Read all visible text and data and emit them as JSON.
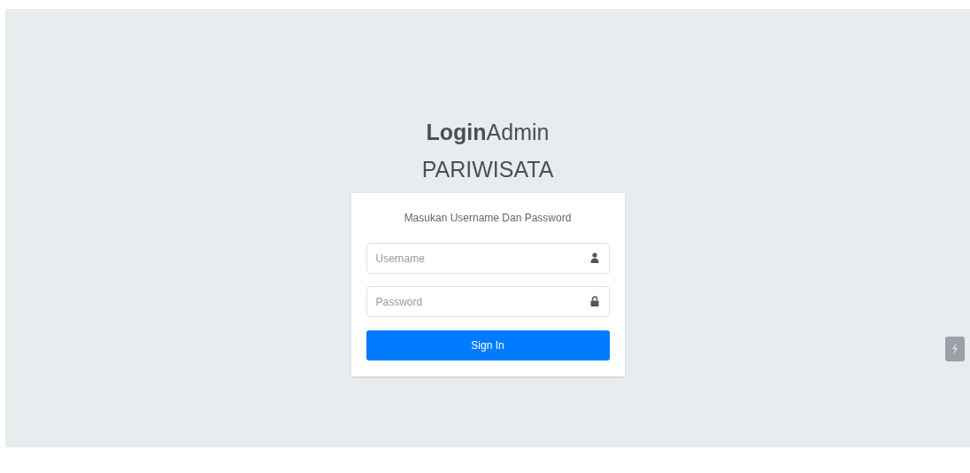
{
  "logo": {
    "title": "**Login**Admin",
    "subtitle": "PARIWISATA"
  },
  "login_box": {
    "message": "Masukan Username Dan Password",
    "fields": [
      {
        "kind": "user",
        "placeholder": "Username"
      },
      {
        "kind": "password",
        "placeholder": "Password"
      }
    ],
    "button": "Sign In"
  }
}
